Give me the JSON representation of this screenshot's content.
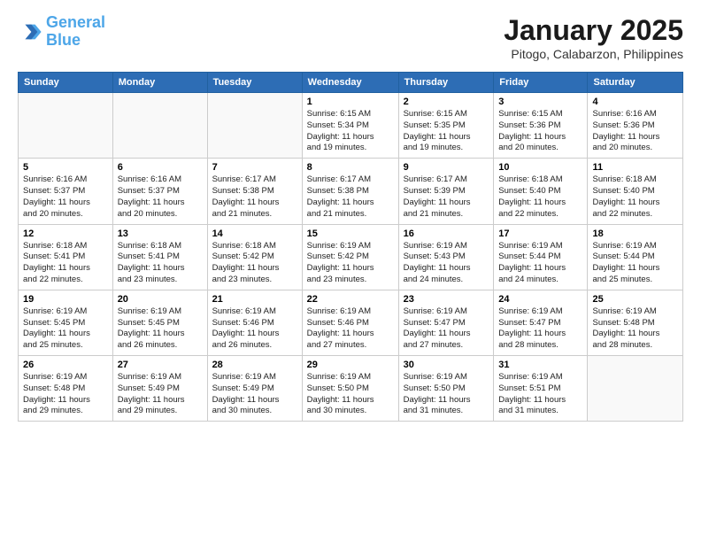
{
  "header": {
    "logo_line1": "General",
    "logo_line2": "Blue",
    "title": "January 2025",
    "location": "Pitogo, Calabarzon, Philippines"
  },
  "weekdays": [
    "Sunday",
    "Monday",
    "Tuesday",
    "Wednesday",
    "Thursday",
    "Friday",
    "Saturday"
  ],
  "weeks": [
    [
      {
        "day": "",
        "text": ""
      },
      {
        "day": "",
        "text": ""
      },
      {
        "day": "",
        "text": ""
      },
      {
        "day": "1",
        "text": "Sunrise: 6:15 AM\nSunset: 5:34 PM\nDaylight: 11 hours\nand 19 minutes."
      },
      {
        "day": "2",
        "text": "Sunrise: 6:15 AM\nSunset: 5:35 PM\nDaylight: 11 hours\nand 19 minutes."
      },
      {
        "day": "3",
        "text": "Sunrise: 6:15 AM\nSunset: 5:36 PM\nDaylight: 11 hours\nand 20 minutes."
      },
      {
        "day": "4",
        "text": "Sunrise: 6:16 AM\nSunset: 5:36 PM\nDaylight: 11 hours\nand 20 minutes."
      }
    ],
    [
      {
        "day": "5",
        "text": "Sunrise: 6:16 AM\nSunset: 5:37 PM\nDaylight: 11 hours\nand 20 minutes."
      },
      {
        "day": "6",
        "text": "Sunrise: 6:16 AM\nSunset: 5:37 PM\nDaylight: 11 hours\nand 20 minutes."
      },
      {
        "day": "7",
        "text": "Sunrise: 6:17 AM\nSunset: 5:38 PM\nDaylight: 11 hours\nand 21 minutes."
      },
      {
        "day": "8",
        "text": "Sunrise: 6:17 AM\nSunset: 5:38 PM\nDaylight: 11 hours\nand 21 minutes."
      },
      {
        "day": "9",
        "text": "Sunrise: 6:17 AM\nSunset: 5:39 PM\nDaylight: 11 hours\nand 21 minutes."
      },
      {
        "day": "10",
        "text": "Sunrise: 6:18 AM\nSunset: 5:40 PM\nDaylight: 11 hours\nand 22 minutes."
      },
      {
        "day": "11",
        "text": "Sunrise: 6:18 AM\nSunset: 5:40 PM\nDaylight: 11 hours\nand 22 minutes."
      }
    ],
    [
      {
        "day": "12",
        "text": "Sunrise: 6:18 AM\nSunset: 5:41 PM\nDaylight: 11 hours\nand 22 minutes."
      },
      {
        "day": "13",
        "text": "Sunrise: 6:18 AM\nSunset: 5:41 PM\nDaylight: 11 hours\nand 23 minutes."
      },
      {
        "day": "14",
        "text": "Sunrise: 6:18 AM\nSunset: 5:42 PM\nDaylight: 11 hours\nand 23 minutes."
      },
      {
        "day": "15",
        "text": "Sunrise: 6:19 AM\nSunset: 5:42 PM\nDaylight: 11 hours\nand 23 minutes."
      },
      {
        "day": "16",
        "text": "Sunrise: 6:19 AM\nSunset: 5:43 PM\nDaylight: 11 hours\nand 24 minutes."
      },
      {
        "day": "17",
        "text": "Sunrise: 6:19 AM\nSunset: 5:44 PM\nDaylight: 11 hours\nand 24 minutes."
      },
      {
        "day": "18",
        "text": "Sunrise: 6:19 AM\nSunset: 5:44 PM\nDaylight: 11 hours\nand 25 minutes."
      }
    ],
    [
      {
        "day": "19",
        "text": "Sunrise: 6:19 AM\nSunset: 5:45 PM\nDaylight: 11 hours\nand 25 minutes."
      },
      {
        "day": "20",
        "text": "Sunrise: 6:19 AM\nSunset: 5:45 PM\nDaylight: 11 hours\nand 26 minutes."
      },
      {
        "day": "21",
        "text": "Sunrise: 6:19 AM\nSunset: 5:46 PM\nDaylight: 11 hours\nand 26 minutes."
      },
      {
        "day": "22",
        "text": "Sunrise: 6:19 AM\nSunset: 5:46 PM\nDaylight: 11 hours\nand 27 minutes."
      },
      {
        "day": "23",
        "text": "Sunrise: 6:19 AM\nSunset: 5:47 PM\nDaylight: 11 hours\nand 27 minutes."
      },
      {
        "day": "24",
        "text": "Sunrise: 6:19 AM\nSunset: 5:47 PM\nDaylight: 11 hours\nand 28 minutes."
      },
      {
        "day": "25",
        "text": "Sunrise: 6:19 AM\nSunset: 5:48 PM\nDaylight: 11 hours\nand 28 minutes."
      }
    ],
    [
      {
        "day": "26",
        "text": "Sunrise: 6:19 AM\nSunset: 5:48 PM\nDaylight: 11 hours\nand 29 minutes."
      },
      {
        "day": "27",
        "text": "Sunrise: 6:19 AM\nSunset: 5:49 PM\nDaylight: 11 hours\nand 29 minutes."
      },
      {
        "day": "28",
        "text": "Sunrise: 6:19 AM\nSunset: 5:49 PM\nDaylight: 11 hours\nand 30 minutes."
      },
      {
        "day": "29",
        "text": "Sunrise: 6:19 AM\nSunset: 5:50 PM\nDaylight: 11 hours\nand 30 minutes."
      },
      {
        "day": "30",
        "text": "Sunrise: 6:19 AM\nSunset: 5:50 PM\nDaylight: 11 hours\nand 31 minutes."
      },
      {
        "day": "31",
        "text": "Sunrise: 6:19 AM\nSunset: 5:51 PM\nDaylight: 11 hours\nand 31 minutes."
      },
      {
        "day": "",
        "text": ""
      }
    ]
  ]
}
